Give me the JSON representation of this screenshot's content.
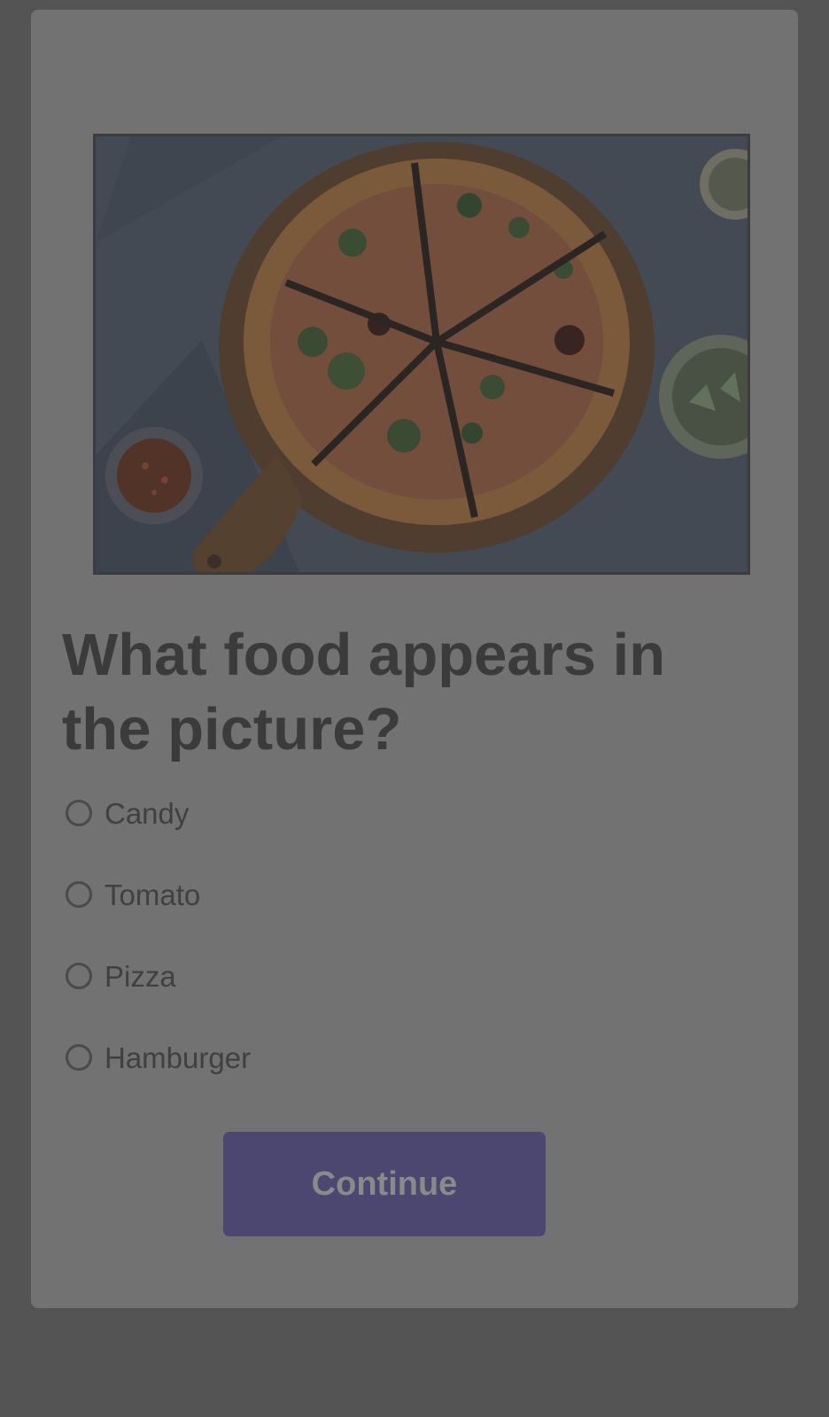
{
  "quiz": {
    "question": "What food appears in the picture?",
    "options": [
      {
        "label": "Candy",
        "selected": false
      },
      {
        "label": "Tomato",
        "selected": false
      },
      {
        "label": "Pizza",
        "selected": false
      },
      {
        "label": "Hamburger",
        "selected": false
      }
    ],
    "continue_label": "Continue"
  },
  "image": {
    "subject": "pizza-photo"
  },
  "colors": {
    "overlay_background": "#545454",
    "card_background": "#727272",
    "button_background": "#4b4770",
    "question_text": "#3b3b3b"
  }
}
